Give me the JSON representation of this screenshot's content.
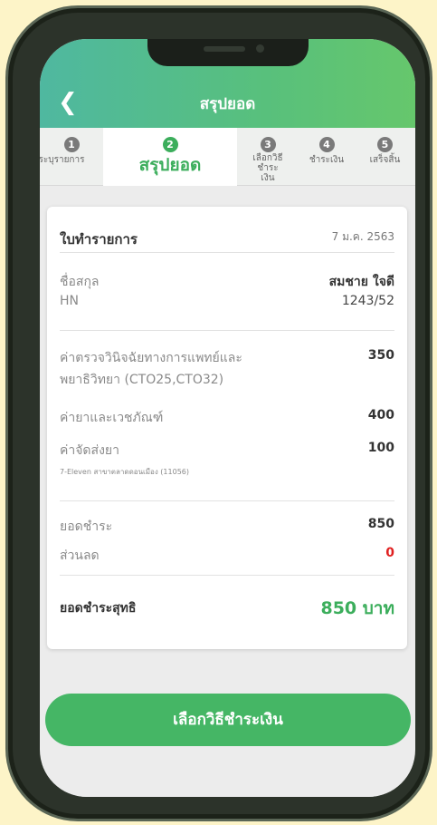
{
  "header": {
    "title": "สรุปยอด",
    "back_icon": "chevron-left-icon"
  },
  "steps": [
    {
      "num": "1",
      "label": "ระบุรายการ"
    },
    {
      "num": "2",
      "label": "สรุปยอด"
    },
    {
      "num": "3",
      "label": "เลือกวิธีชำระเงิน"
    },
    {
      "num": "4",
      "label": "ชำระเงิน"
    },
    {
      "num": "5",
      "label": "เสร็จสิ้น"
    }
  ],
  "document": {
    "title": "ใบทำรายการ",
    "date": "7 ม.ค. 2563"
  },
  "patient": {
    "name_label": "ชื่อสกุล",
    "name_value": "สมชาย ใจดี",
    "hn_label": "HN",
    "hn_value": "1243/52"
  },
  "items": [
    {
      "label_line1": "ค่าตรวจวินิจฉัยทางการแพทย์และ",
      "label_line2": "พยาธิวิทยา (CTO25,CTO32)",
      "value": "350"
    },
    {
      "label": "ค่ายาและเวชภัณฑ์",
      "value": "400"
    },
    {
      "label": "ค่าจัดส่งยา",
      "value": "100",
      "note": "7-Eleven สาขาตลาดดอนเมือง (11056)"
    }
  ],
  "summary": {
    "subtotal_label": "ยอดชำระ",
    "subtotal_value": "850",
    "discount_label": "ส่วนลด",
    "discount_value": "0",
    "net_label": "ยอดชำระสุทธิ",
    "net_value": "850 บาท"
  },
  "button": {
    "label": "เลือกวิธีชำระเงิน"
  },
  "colors": {
    "accent": "#3cae5c",
    "header_start": "#4fb8a0",
    "header_end": "#66c76c",
    "discount": "#e02020"
  }
}
